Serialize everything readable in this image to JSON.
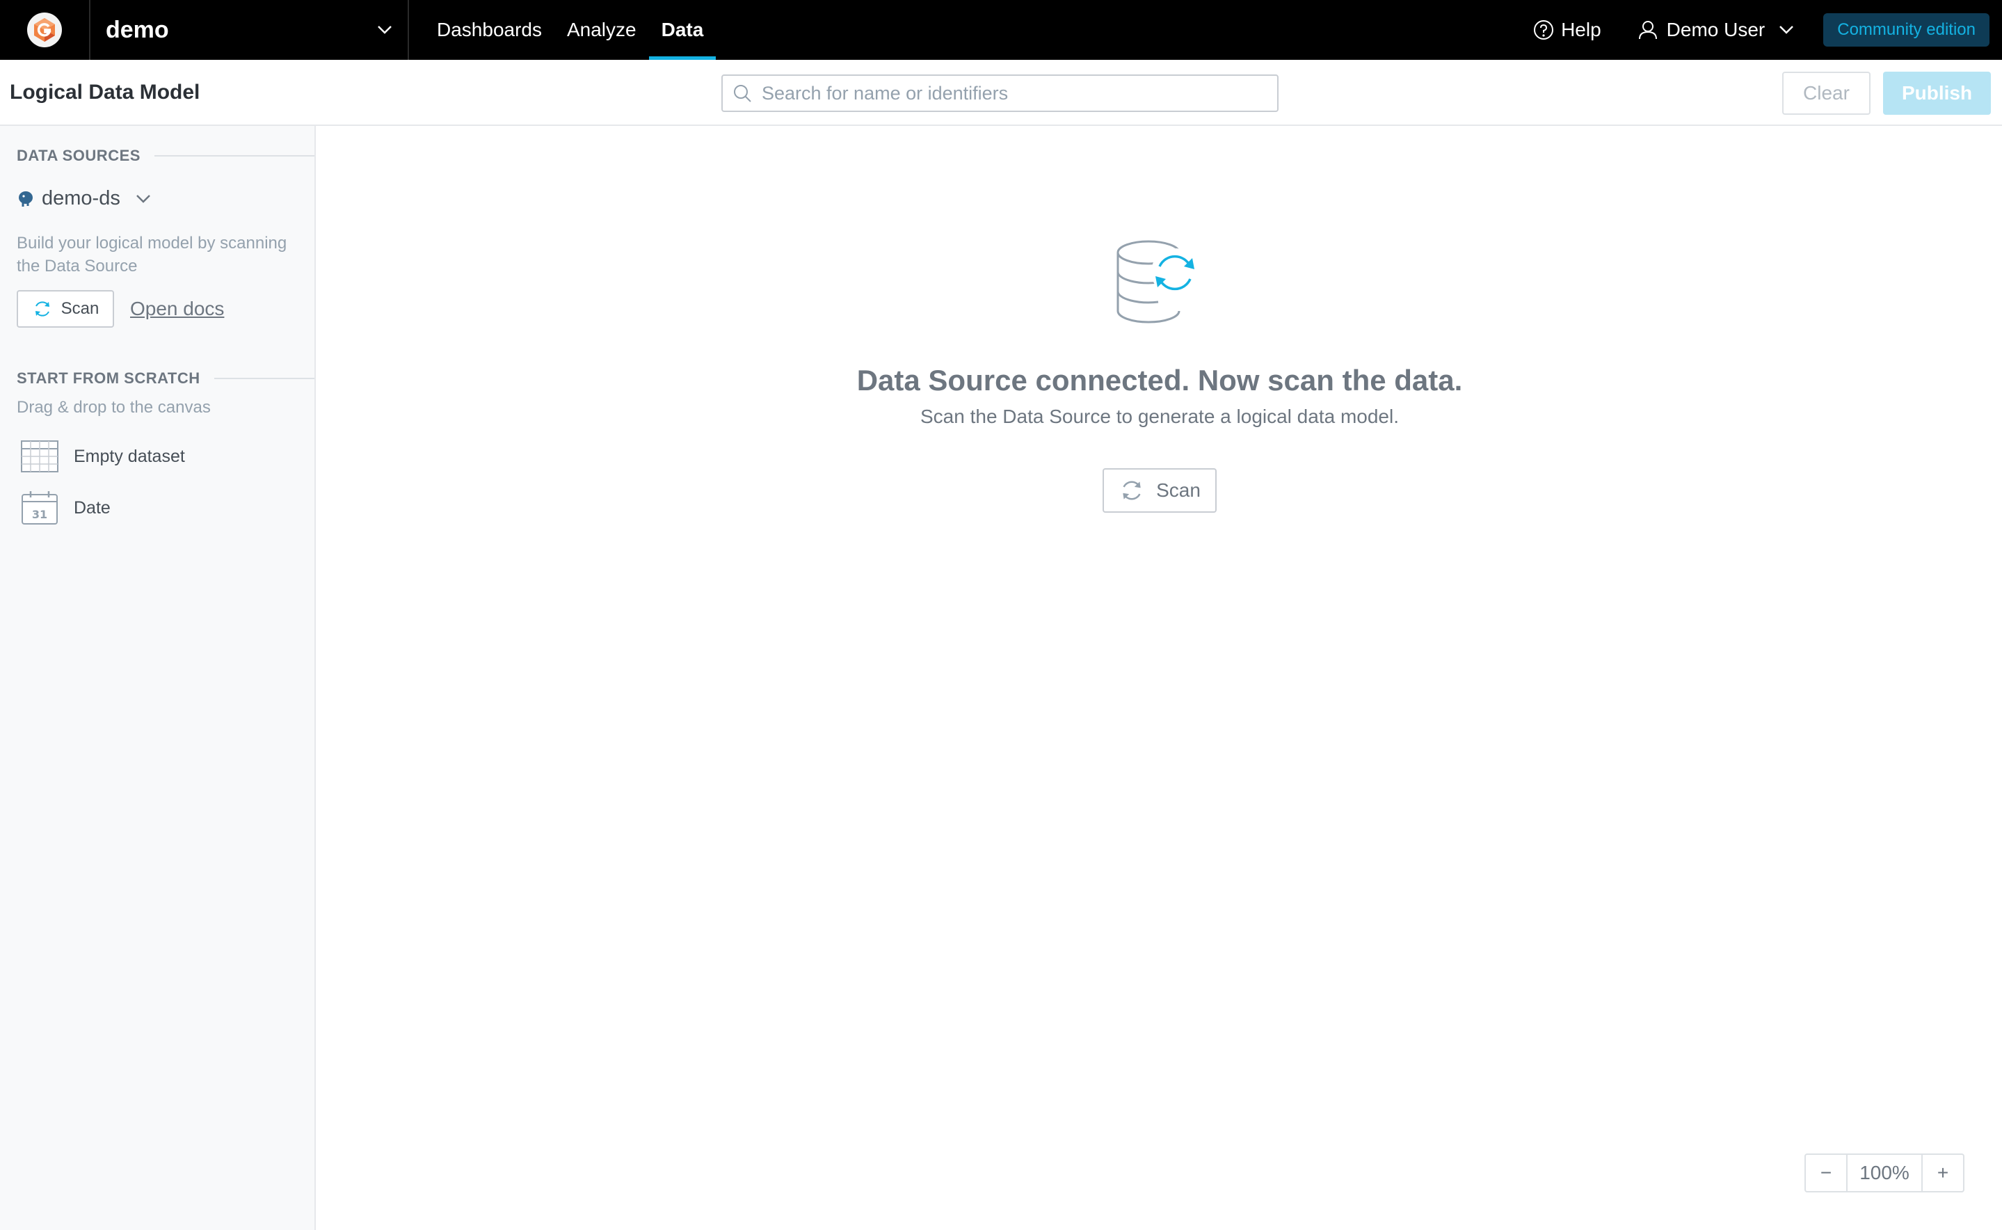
{
  "topbar": {
    "workspace": "demo",
    "nav": [
      {
        "label": "Dashboards",
        "active": false
      },
      {
        "label": "Analyze",
        "active": false
      },
      {
        "label": "Data",
        "active": true
      }
    ],
    "help_label": "Help",
    "user_label": "Demo User",
    "edition_badge": "Community edition",
    "accent_color": "#14b2e2"
  },
  "toolbar": {
    "title": "Logical Data Model",
    "search_placeholder": "Search for name or identifiers",
    "clear_label": "Clear",
    "publish_label": "Publish"
  },
  "sidebar": {
    "data_sources_heading": "DATA SOURCES",
    "data_source_name": "demo-ds",
    "scan_hint": "Build your logical model by scanning the Data Source",
    "scan_label": "Scan",
    "open_docs_label": "Open docs",
    "scratch_heading": "START FROM SCRATCH",
    "scratch_hint": "Drag & drop to the canvas",
    "items": [
      {
        "label": "Empty dataset",
        "icon": "table-icon"
      },
      {
        "label": "Date",
        "icon": "calendar-icon"
      }
    ]
  },
  "canvas": {
    "empty_title": "Data Source connected. Now scan the data.",
    "empty_subtitle": "Scan the Data Source to generate a logical data model.",
    "scan_label": "Scan",
    "zoom_minus": "−",
    "zoom_value": "100%",
    "zoom_plus": "+"
  }
}
